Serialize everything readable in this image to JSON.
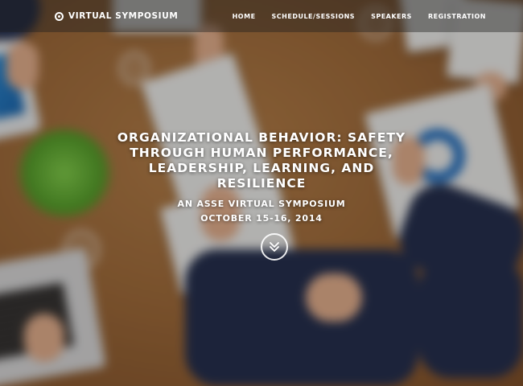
{
  "brand": {
    "name": "VIRTUAL SYMPOSIUM",
    "icon": "circle-dot-icon"
  },
  "nav": {
    "items": [
      {
        "label": "HOME"
      },
      {
        "label": "SCHEDULE/SESSIONS"
      },
      {
        "label": "SPEAKERS"
      },
      {
        "label": "REGISTRATION"
      }
    ]
  },
  "hero": {
    "title_lines": [
      "ORGANIZATIONAL BEHAVIOR: SAFETY",
      "THROUGH HUMAN PERFORMANCE,",
      "LEADERSHIP, LEARNING, AND",
      "RESILIENCE"
    ],
    "subtitle": "AN ASSE VIRTUAL SYMPOSIUM",
    "date": "OCTOBER 15-16, 2014",
    "scroll_icon": "double-chevron-down-icon"
  },
  "colors": {
    "nav_bg": "#1e1e1e",
    "text": "#ffffff",
    "wood": "#a06a37"
  }
}
